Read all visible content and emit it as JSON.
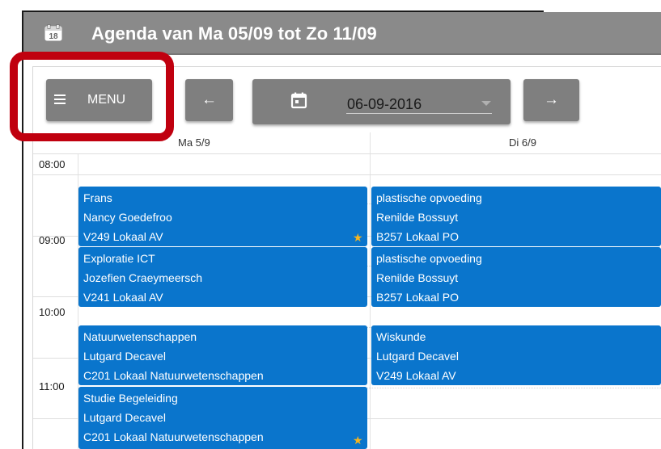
{
  "titlebar": {
    "title": "Agenda van Ma 05/09 tot Zo 11/09",
    "icon": "calendar-18-icon"
  },
  "toolbar": {
    "menu_label": "MENU",
    "prev_icon": "arrow-left-icon",
    "next_icon": "arrow-right-icon",
    "date_value": "06-09-2016",
    "highlight_color": "#c0000f"
  },
  "calendar": {
    "days": [
      "Ma 5/9",
      "Di 6/9"
    ],
    "times": [
      "08:00",
      "09:00",
      "10:00",
      "11:00"
    ],
    "event_color": "#0a75cc",
    "events": {
      "mon_1": {
        "subject": "Frans",
        "teacher": "Nancy Goedefroo",
        "room": "V249 Lokaal AV",
        "starred": true
      },
      "mon_2": {
        "subject": "Exploratie ICT",
        "teacher": "Jozefien Craeymeersch",
        "room": "V241 Lokaal AV",
        "starred": false
      },
      "mon_3": {
        "subject": "Natuurwetenschappen",
        "teacher": "Lutgard Decavel",
        "room": "C201 Lokaal Natuurwetenschappen",
        "starred": false
      },
      "mon_4": {
        "subject": "Studie Begeleiding",
        "teacher": "Lutgard Decavel",
        "room": "C201 Lokaal Natuurwetenschappen",
        "starred": true
      },
      "tue_1": {
        "subject": "plastische opvoeding",
        "teacher": "Renilde Bossuyt",
        "room": "B257 Lokaal PO",
        "starred": false
      },
      "tue_2": {
        "subject": "plastische opvoeding",
        "teacher": "Renilde Bossuyt",
        "room": "B257 Lokaal PO",
        "starred": false
      },
      "tue_3": {
        "subject": "Wiskunde",
        "teacher": "Lutgard Decavel",
        "room": "V249 Lokaal AV",
        "starred": false
      }
    }
  }
}
